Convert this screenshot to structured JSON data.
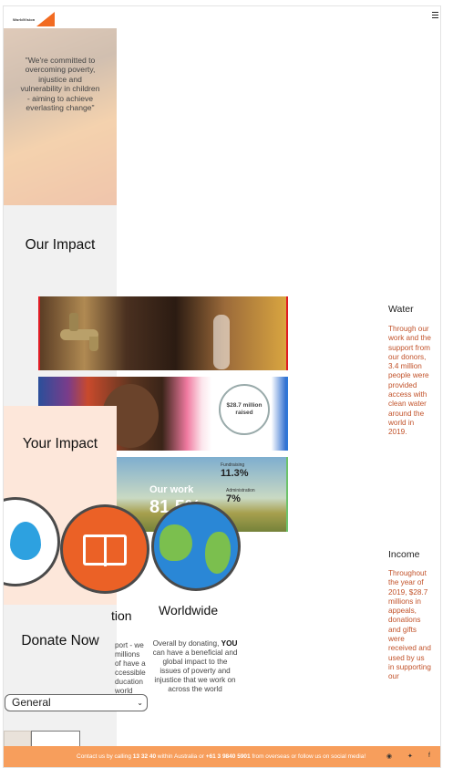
{
  "header": {
    "logo_text": "WorldVision",
    "menu_icon": "hamburger-icon"
  },
  "hero": {
    "quote": "\"We're committed to overcoming poverty, injustice and vulnerability in children - aiming to achieve everlasting change\""
  },
  "impact": {
    "title": "Our Impact"
  },
  "your_impact": {
    "title": "Your Impact"
  },
  "images": {
    "income_badge": "$28.7 million raised",
    "our_work": "Our work",
    "big_number": "81.5%",
    "fundraising_label": "Fundraising",
    "fundraising_value": "11.3%",
    "admin_label": "Administration",
    "admin_value": "7%"
  },
  "circles": [
    {
      "name": "water",
      "icon": "water-drop-icon"
    },
    {
      "name": "education",
      "icon": "book-icon"
    },
    {
      "name": "worldwide",
      "icon": "globe-icon"
    }
  ],
  "education": {
    "label": "tion",
    "text": "port - we millions of have a ccessible ducation world"
  },
  "worldwide": {
    "label": "Worldwide",
    "text_before": "Overall by donating,",
    "text_bold": "YOU",
    "text_after": "can have a beneficial and global impact to the issues of poverty and injustice that we work on across the world"
  },
  "water": {
    "title": "Water",
    "text": "Through our work and the support from our donors, 3.4 million people were provided access with clean water around the world in 2019."
  },
  "income": {
    "title": "Income",
    "text": "Throughout the year of 2019, $28.7 millions in appeals, donations and gifts were received and used by us in supporting our"
  },
  "donate": {
    "title": "Donate Now",
    "fund_selected": "General"
  },
  "footer": {
    "text_1": "Contact us by calling",
    "phone_1": "13 32 40",
    "text_2": "within Australia or",
    "phone_2": "+61 3 9840 5901",
    "text_3": "from overseas or follow us on social media!",
    "icons": [
      "instagram-icon",
      "twitter-icon",
      "facebook-icon"
    ]
  },
  "colors": {
    "brand_orange": "#f26b21",
    "footer_bg": "#f79e5c",
    "your_impact_bg": "#fde7da",
    "right_text": "#c2532b",
    "water_blue": "#2da1e0",
    "book_orange": "#eb6126"
  }
}
